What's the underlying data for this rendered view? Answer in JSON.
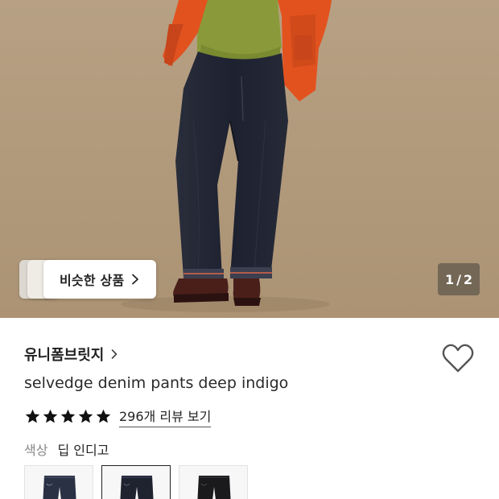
{
  "hero": {
    "similar_products_label": "비슷한 상품",
    "page_indicator": {
      "current": "1",
      "separator": "/",
      "total": "2"
    }
  },
  "product": {
    "brand": "유니폼브릿지",
    "title": "selvedge denim pants deep indigo",
    "rating": {
      "stars": 5,
      "review_link_text": "296개 리뷰 보기"
    },
    "color": {
      "label": "색상",
      "value": "딥 인디고"
    },
    "swatches": [
      {
        "icon": "jeans-dark-indigo",
        "selected": false
      },
      {
        "icon": "jeans-deep-indigo",
        "selected": true
      },
      {
        "icon": "jeans-black",
        "selected": false
      }
    ]
  },
  "colors": {
    "background": "#b49d80",
    "jacket": "#e2521f",
    "sweatshirt": "#8a9a3a",
    "denim": "#1f2330",
    "star": "#111111"
  }
}
